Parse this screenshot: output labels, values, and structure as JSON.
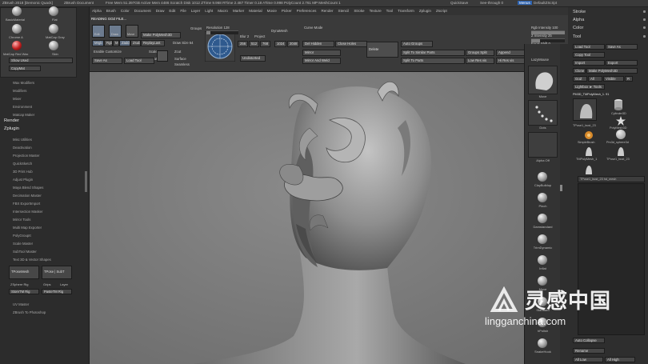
{
  "titlebar": {
    "app": "ZBrush 2018 [Demonic Quack]",
    "doc": "ZBrush Document",
    "stats": "Free Mem 51.397GB  Active Mem 4486  Scratch Disk 1012  ZTime 9.968 RTime 2.487 Timer 0.18 ATime 0.998  PolyCount 2.761 MP  MeshCount 1",
    "quicksave": "QuickSave",
    "seethrough": "See-through  0",
    "menus_label": "Menus",
    "script": "DefaultZScript"
  },
  "menubar": [
    "Alpha",
    "Brush",
    "Color",
    "Document",
    "Draw",
    "Edit",
    "File",
    "Layer",
    "Light",
    "Macro",
    "Marker",
    "Material",
    "Movie",
    "Picker",
    "Preferences",
    "Render",
    "Stencil",
    "Stroke",
    "Texture",
    "Tool",
    "Transform",
    "Zplugin",
    "Zscript"
  ],
  "status_msg": "READING GOZ FILE...",
  "right_top": [
    "Stroke",
    "Alpha",
    "Color",
    "Tool"
  ],
  "left": {
    "materials": [
      {
        "name": "BasicMaterial",
        "color": "gray"
      },
      {
        "name": "Flat",
        "color": "gray"
      },
      {
        "name": "Chrome A",
        "color": "gray"
      },
      {
        "name": "MatCap Gray",
        "color": "gray"
      },
      {
        "name": "MatCap Red Wax",
        "color": "red"
      },
      {
        "name": "Skin",
        "color": "gray"
      }
    ],
    "show_used": "Show Used",
    "copy_mat": "CopyMat",
    "plugin_items_top": [
      "Wax Modifiers",
      "Modifiers",
      "Mixer",
      "Environment",
      "Matcap Maker"
    ],
    "render": "Render",
    "zplugin": "Zplugin",
    "plugin_items": [
      "Misc Utilities",
      "Deactivation",
      "Projection Master",
      "QuickSketch",
      "3D Print Hub",
      "Adjust Plugin",
      "Maya Blend Shapes",
      "Decimation Master",
      "FBX ExportImport",
      "Intersection Masker",
      "Mirror Tools",
      "Multi Map Exporter",
      "PolyGroupIt",
      "Scale Master",
      "SubTool Master",
      "Text 3D & Vector Shapes"
    ],
    "buttons": [
      "TPoseMesh",
      "TPose | SubT",
      "ZSphere Rig",
      "Grips",
      "Layer",
      "StoreTM Rig",
      "PasteTM Rig"
    ],
    "bottom_items": [
      "UV Master",
      "ZBrush To Photoshop"
    ]
  },
  "shelf": {
    "edit": "Edit",
    "draw": "Draw",
    "move": "Move",
    "scale": "Scale",
    "rotate": "Rotate",
    "make_polymesh": "Make PolyMesh3D",
    "replay_last": "ReplayLast",
    "mrgb": "Mrgb",
    "rgb": "Rgb",
    "m": "M",
    "zadd": "Zadd",
    "zsub": "Zsub",
    "zcut": "Zcut",
    "rgb_intensity": "Rgb Intensity 100",
    "z_intensity": "Z Intensity 25",
    "focal_shift": "Focal Shift 0",
    "draw_size": "Draw Size 64",
    "enable_customize": "Enable Customize",
    "save_as": "Save As",
    "load_tool": "Load Tool",
    "groups": "Groups",
    "dynamesh": "DynaMesh",
    "resolution": "Resolution 128",
    "blur": "Blur 2",
    "project": "Project",
    "polish": "Polish",
    "sub_res": [
      "256",
      "512",
      "768",
      "1024",
      "2048"
    ],
    "undistorted": "Undistorted",
    "surface": "Surface",
    "seamless": "Seamless",
    "curve_mode": "Curve Mode",
    "del_hidden": "Del Hidden",
    "close_holes": "Close Holes",
    "mirror": "Mirror",
    "mirror_weld": "Mirror And Weld",
    "delete": "Delete",
    "auto_groups": "Auto Groups",
    "split_similar": "Split To Similar Parts",
    "split_parts": "Split To Parts",
    "groups_split": "Groups Split",
    "append": "Append",
    "low_res_vis": "Low Res vis",
    "hi_res_vis": "Hi Res vis"
  },
  "right_strip": {
    "move": "Move",
    "dots": "Dots",
    "alpha_off": "Alpha Off",
    "brushes": [
      "ClayBuildup",
      "Pinch",
      "Damstandard",
      "TrimDynamic",
      "Inflat",
      "Move",
      "Standard",
      "hPolish",
      "SnakeHook"
    ]
  },
  "tool_panel": {
    "load_tool": "Load Tool",
    "save_as": "Save As",
    "copy_tool": "Copy Tool",
    "paste_tool": "Paste Tool",
    "import": "Import",
    "export": "Export",
    "clone": "Clone",
    "make_polymesh": "Make PolyMesh3D",
    "goz": "GoZ",
    "all": "All",
    "visible": "Visible",
    "r": "R",
    "lightbox_tools": "Lightbox ► Tools",
    "current_tool": "PM3D_TMPolyMesh_1. 91",
    "thumbs": [
      "TPose1_bust_23",
      "Cylinder3D",
      "PolyMesh3D",
      "SimpleBrush",
      "Pm3d_sphere3d",
      "TMPolyMesh_1",
      "TPose1_bust_23"
    ],
    "subtool_name": "TPose1_bust_23 hd_mesh",
    "auto_collapse": "Auto Collapse",
    "rename": "Rename",
    "all_low": "All Low",
    "all_high": "All High"
  },
  "watermark": {
    "zh": "灵感中国",
    "en": "lingganchina.com"
  },
  "colors": {
    "panel": "#2c2c2c",
    "shelf": "#3a3a3a",
    "viewport": "#7e7e7e",
    "accent": "#2e63b0"
  }
}
